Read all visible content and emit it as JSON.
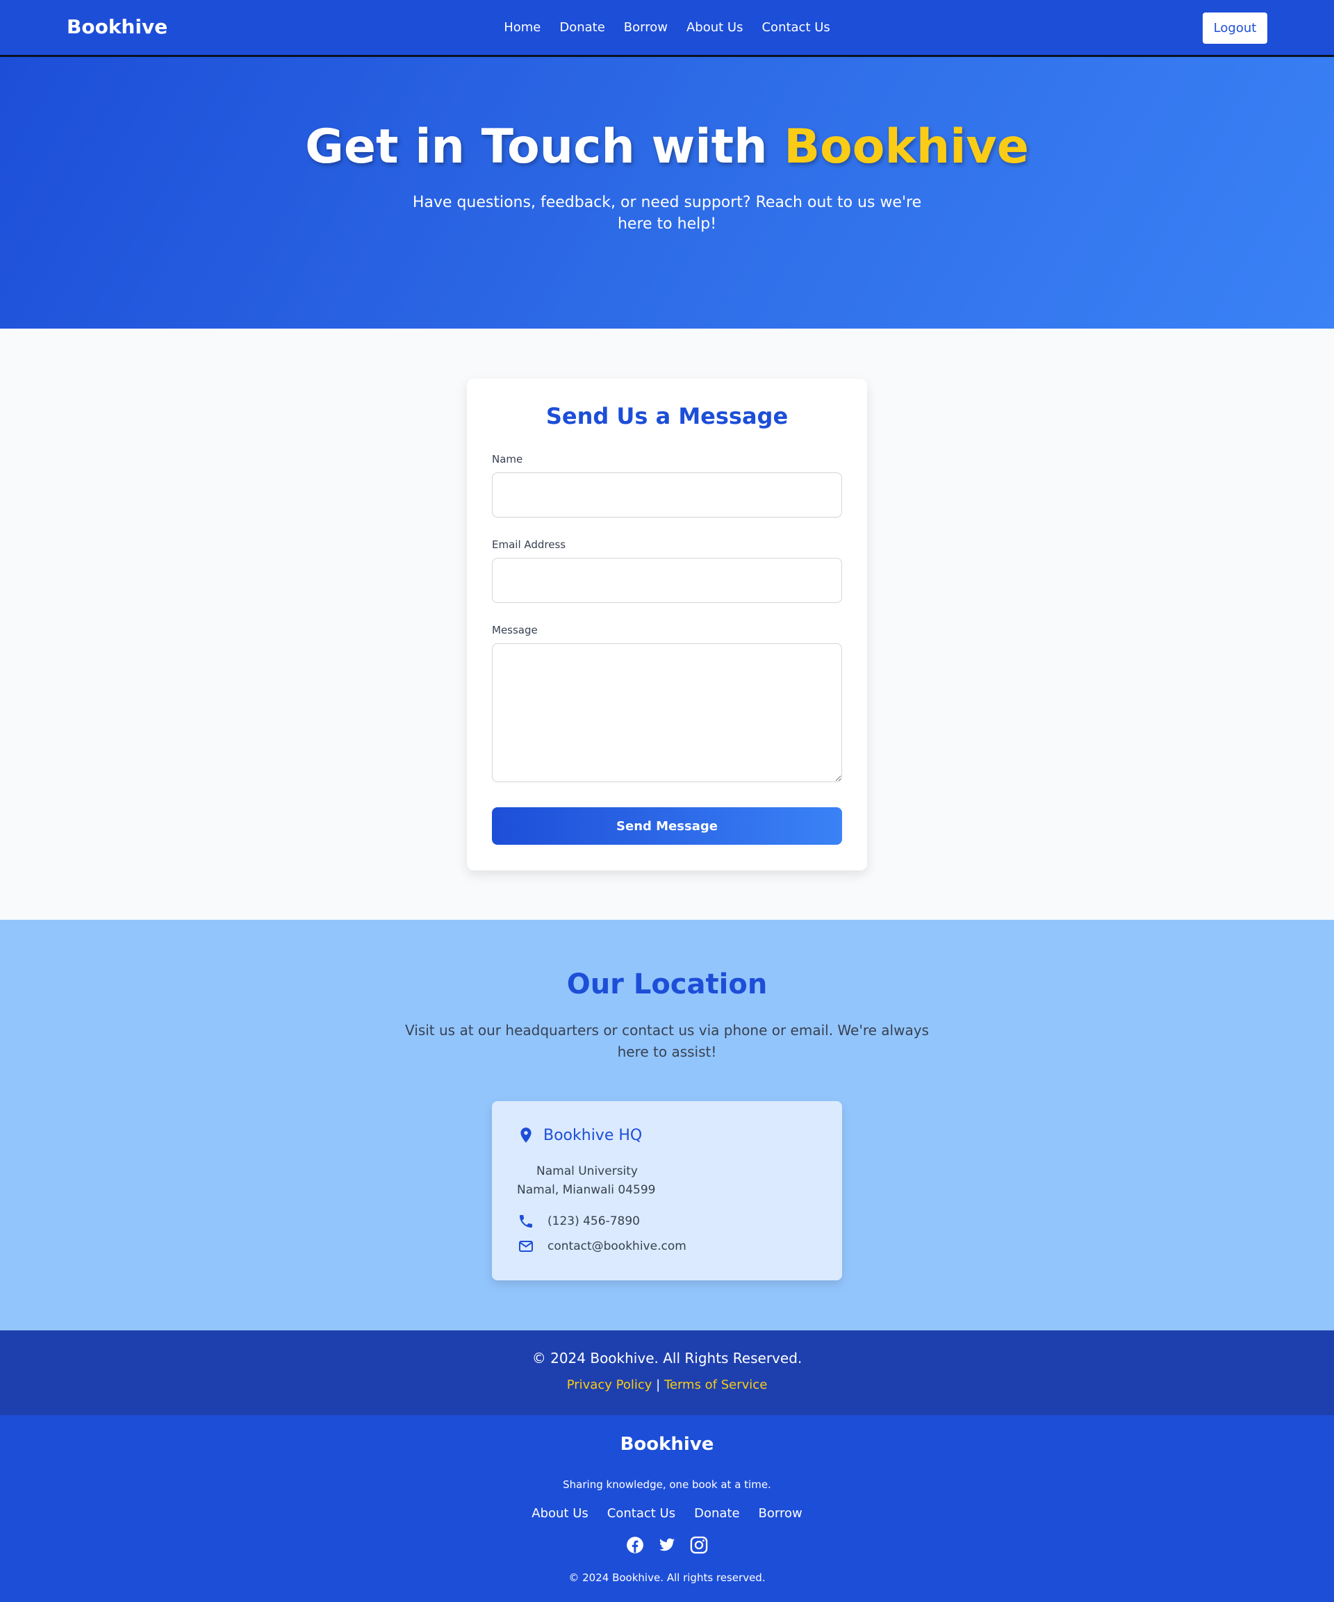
{
  "nav": {
    "brand": "Bookhive",
    "links": [
      "Home",
      "Donate",
      "Borrow",
      "About Us",
      "Contact Us"
    ],
    "logout": "Logout"
  },
  "hero": {
    "title_prefix": "Get in Touch with ",
    "title_accent": "Bookhive",
    "subtitle": "Have questions, feedback, or need support? Reach out to us we're here to help!"
  },
  "form": {
    "title": "Send Us a Message",
    "name_label": "Name",
    "name_value": "",
    "email_label": "Email Address",
    "email_value": "",
    "message_label": "Message",
    "message_value": "",
    "submit": "Send Message"
  },
  "location": {
    "title": "Our Location",
    "subtitle": "Visit us at our headquarters or contact us via phone or email. We're always here to assist!",
    "hq_name": "Bookhive HQ",
    "address_line1": "Namal University",
    "address_line2": "Namal, Mianwali 04599",
    "phone": "(123) 456-7890",
    "email": "contact@bookhive.com"
  },
  "footer_top": {
    "copyright": "© 2024 Bookhive. All Rights Reserved.",
    "privacy": "Privacy Policy",
    "separator": "|",
    "terms": "Terms of Service"
  },
  "footer_bottom": {
    "brand": "Bookhive",
    "tagline": "Sharing knowledge, one book at a time.",
    "links": [
      "About Us",
      "Contact Us",
      "Donate",
      "Borrow"
    ],
    "social": [
      "facebook-icon",
      "twitter-icon",
      "instagram-icon"
    ],
    "copyright": "© 2024 Bookhive. All rights reserved."
  },
  "colors": {
    "primary": "#1d4ed8",
    "accent": "#facc15",
    "location_bg": "#93c5fd",
    "footer_dark": "#1e40af"
  }
}
